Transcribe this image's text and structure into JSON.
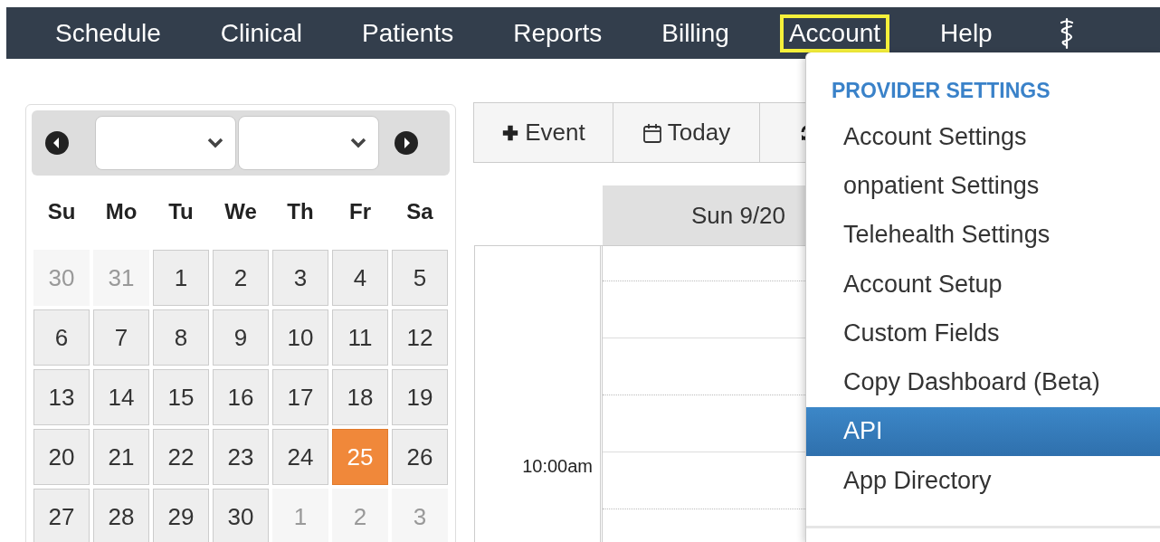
{
  "nav": {
    "items": [
      {
        "kind": "text",
        "label": "Schedule",
        "selected": false
      },
      {
        "kind": "text",
        "label": "Clinical",
        "selected": false
      },
      {
        "kind": "text",
        "label": "Patients",
        "selected": false
      },
      {
        "kind": "text",
        "label": "Reports",
        "selected": false
      },
      {
        "kind": "text",
        "label": "Billing",
        "selected": false
      },
      {
        "kind": "text",
        "label": "Account",
        "selected": true
      },
      {
        "kind": "text",
        "label": "Help",
        "selected": false
      },
      {
        "kind": "icon",
        "selected": false
      }
    ]
  },
  "mini_calendar": {
    "weekdays": [
      "Su",
      "Mo",
      "Tu",
      "We",
      "Th",
      "Fr",
      "Sa"
    ],
    "days": [
      {
        "label": "30",
        "muted": true,
        "selected": false
      },
      {
        "label": "31",
        "muted": true,
        "selected": false
      },
      {
        "label": "1",
        "muted": false,
        "selected": false
      },
      {
        "label": "2",
        "muted": false,
        "selected": false
      },
      {
        "label": "3",
        "muted": false,
        "selected": false
      },
      {
        "label": "4",
        "muted": false,
        "selected": false
      },
      {
        "label": "5",
        "muted": false,
        "selected": false
      },
      {
        "label": "6",
        "muted": false,
        "selected": false
      },
      {
        "label": "7",
        "muted": false,
        "selected": false
      },
      {
        "label": "8",
        "muted": false,
        "selected": false
      },
      {
        "label": "9",
        "muted": false,
        "selected": false
      },
      {
        "label": "10",
        "muted": false,
        "selected": false
      },
      {
        "label": "11",
        "muted": false,
        "selected": false
      },
      {
        "label": "12",
        "muted": false,
        "selected": false
      },
      {
        "label": "13",
        "muted": false,
        "selected": false
      },
      {
        "label": "14",
        "muted": false,
        "selected": false
      },
      {
        "label": "15",
        "muted": false,
        "selected": false
      },
      {
        "label": "16",
        "muted": false,
        "selected": false
      },
      {
        "label": "17",
        "muted": false,
        "selected": false
      },
      {
        "label": "18",
        "muted": false,
        "selected": false
      },
      {
        "label": "19",
        "muted": false,
        "selected": false
      },
      {
        "label": "20",
        "muted": false,
        "selected": false
      },
      {
        "label": "21",
        "muted": false,
        "selected": false
      },
      {
        "label": "22",
        "muted": false,
        "selected": false
      },
      {
        "label": "23",
        "muted": false,
        "selected": false
      },
      {
        "label": "24",
        "muted": false,
        "selected": false
      },
      {
        "label": "25",
        "muted": false,
        "selected": true
      },
      {
        "label": "26",
        "muted": false,
        "selected": false
      },
      {
        "label": "27",
        "muted": false,
        "selected": false
      },
      {
        "label": "28",
        "muted": false,
        "selected": false
      },
      {
        "label": "29",
        "muted": false,
        "selected": false
      },
      {
        "label": "30",
        "muted": false,
        "selected": false
      },
      {
        "label": "1",
        "muted": true,
        "selected": false
      },
      {
        "label": "2",
        "muted": true,
        "selected": false
      },
      {
        "label": "3",
        "muted": true,
        "selected": false
      }
    ]
  },
  "toolbar": {
    "buttons": [
      {
        "kind": "add",
        "label": "Event"
      },
      {
        "kind": "today",
        "label": "Today"
      },
      {
        "kind": "refresh"
      }
    ]
  },
  "schedule": {
    "day_header": "Sun 9/20",
    "time_label": "10:00am"
  },
  "account_menu": {
    "section": "PROVIDER SETTINGS",
    "items": [
      {
        "label": "Account Settings",
        "selected": false
      },
      {
        "label": "onpatient Settings",
        "selected": false
      },
      {
        "label": "Telehealth Settings",
        "selected": false
      },
      {
        "label": "Account Setup",
        "selected": false
      },
      {
        "label": "Custom Fields",
        "selected": false
      },
      {
        "label": "Copy Dashboard (Beta)",
        "selected": false
      },
      {
        "label": "API",
        "selected": true
      },
      {
        "label": "App Directory",
        "selected": false
      }
    ]
  }
}
